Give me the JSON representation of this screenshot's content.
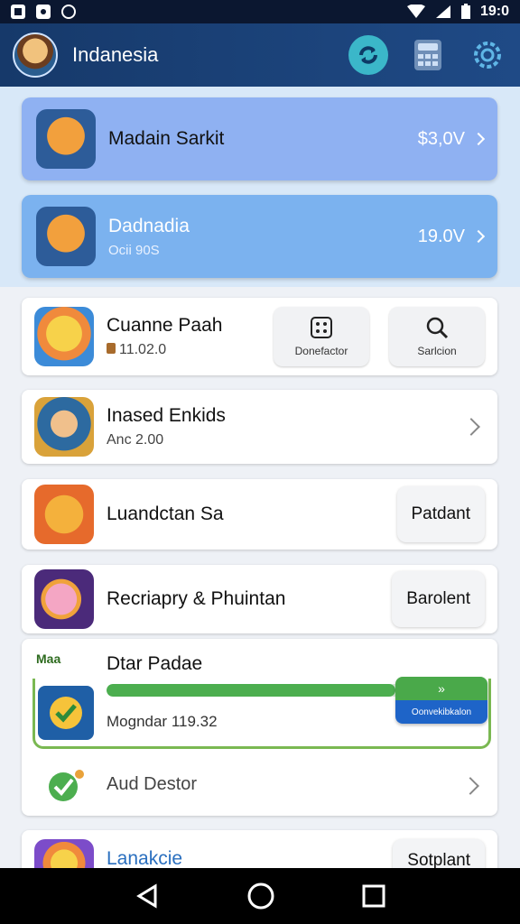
{
  "statusbar": {
    "time": "19:0"
  },
  "appbar": {
    "title": "Indanesia"
  },
  "highlights": [
    {
      "name": "Madain Sarkit",
      "sub": "",
      "price": "$3,0V",
      "bg": "#8fb1f2"
    },
    {
      "name": "Dadnadia",
      "sub": "Ocii 90S",
      "price": "19.0V",
      "bg": "#7bb2ef"
    }
  ],
  "cards": {
    "c1": {
      "name": "Cuanne Paah",
      "sub": "11.02.0",
      "tool1": "Donefactor",
      "tool2": "Sarlcion"
    },
    "c2": {
      "name": "Inased Enkids",
      "sub": "Anc 2.00"
    },
    "c3": {
      "name": "Luandctan Sa",
      "action": "Patdant"
    },
    "c4": {
      "name": "Recriapry & Phuintan",
      "action": "Barolent"
    },
    "c5": {
      "name": "Dtar Padae",
      "badge": "Maa",
      "progress_text": "Mogndar 119.32",
      "progress": 0.82,
      "btn_top": "»",
      "btn_bottom": "Oonvekibkalon",
      "footer": "Aud Destor"
    },
    "c6": {
      "name": "Lanakcie",
      "action": "Sotplant"
    }
  }
}
